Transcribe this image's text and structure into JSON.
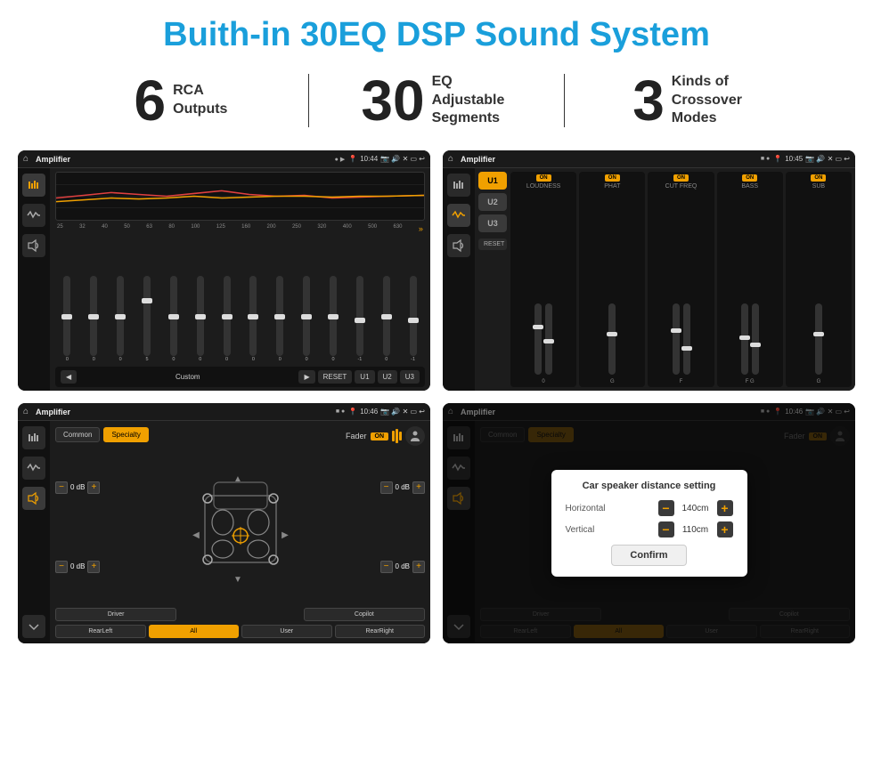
{
  "header": {
    "title": "Buith-in 30EQ DSP Sound System"
  },
  "stats": [
    {
      "number": "6",
      "label": "RCA\nOutputs"
    },
    {
      "number": "30",
      "label": "EQ Adjustable\nSegments"
    },
    {
      "number": "3",
      "label": "Kinds of\nCrossover Modes"
    }
  ],
  "screens": [
    {
      "id": "eq-screen",
      "statusbar": {
        "title": "Amplifier",
        "time": "10:44"
      },
      "type": "eq"
    },
    {
      "id": "crossover-screen",
      "statusbar": {
        "title": "Amplifier",
        "time": "10:45"
      },
      "type": "crossover"
    },
    {
      "id": "fader-screen",
      "statusbar": {
        "title": "Amplifier",
        "time": "10:46"
      },
      "type": "fader"
    },
    {
      "id": "distance-screen",
      "statusbar": {
        "title": "Amplifier",
        "time": "10:46"
      },
      "type": "distance"
    }
  ],
  "eq": {
    "frequencies": [
      "25",
      "32",
      "40",
      "50",
      "63",
      "80",
      "100",
      "125",
      "160",
      "200",
      "250",
      "320",
      "400",
      "500",
      "630"
    ],
    "values": [
      "0",
      "0",
      "0",
      "5",
      "0",
      "0",
      "0",
      "0",
      "0",
      "0",
      "0",
      "-1",
      "0",
      "-1"
    ],
    "mode_label": "Custom",
    "buttons": [
      "RESET",
      "U1",
      "U2",
      "U3"
    ]
  },
  "crossover": {
    "u_buttons": [
      "U1",
      "U2",
      "U3"
    ],
    "panels": [
      "LOUDNESS",
      "PHAT",
      "CUT FREQ",
      "BASS",
      "SUB"
    ],
    "on_label": "ON",
    "reset_label": "RESET"
  },
  "fader": {
    "tabs": [
      "Common",
      "Specialty"
    ],
    "active_tab": "Specialty",
    "fader_label": "Fader",
    "on_label": "ON",
    "vol_left_front": "0 dB",
    "vol_right_front": "0 dB",
    "vol_left_rear": "0 dB",
    "vol_right_rear": "0 dB",
    "buttons": [
      "Driver",
      "",
      "Copilot",
      "RearLeft",
      "All",
      "User",
      "RearRight"
    ]
  },
  "distance_dialog": {
    "title": "Car speaker distance setting",
    "horizontal_label": "Horizontal",
    "horizontal_value": "140cm",
    "vertical_label": "Vertical",
    "vertical_value": "110cm",
    "confirm_label": "Confirm"
  }
}
